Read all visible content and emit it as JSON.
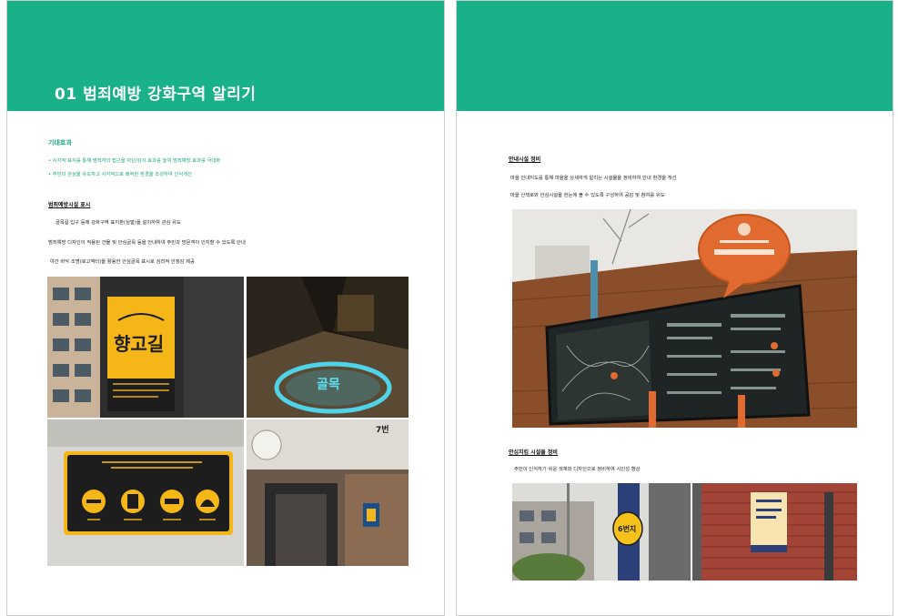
{
  "left_page": {
    "title": "01 범죄예방 강화구역 알리기",
    "section_title": "기대효과",
    "bullets": [
      "• 시각적 표지를 통해 범죄자의 접근을 차단/감시 효과를 높여 범죄예방 효과를 극대화",
      "• 주민의 관심을 유도하고 시각적으로 쾌적한 환경을 조성하여 인식개선"
    ],
    "subheading": "범죄예방시설 표시",
    "lines": [
      "골목길 입구 등에 강화구역 표지판(심벌)을 설치하여 관심 유도",
      "범죄예방 디자인이 적용된 건물 및 안심골목 등을 안내하여 주민과 방문객이 인지할 수 있도록 안내",
      "야간 바닥 조명(로고젝터)을 활용한 안심골목 표시로 심리적 안정감 제공"
    ],
    "photo_texts": {
      "yellow_sign_title": "향고길",
      "floor_light": "골목",
      "footprint_sign": "7번"
    }
  },
  "right_page": {
    "subheading_1": "안내시설 정비",
    "lines_1": [
      "마을 안내지도를 통해 마을을 상세하게 알리는 시설물을 정비하여 안내 환경을 개선",
      "마을 산책로와 안심시설을 한눈에 볼 수 있도록 구성하여 공감 및 참여를 유도"
    ],
    "subheading_2": "안심지킴 시설물 정비",
    "lines_2": [
      "주민이 인식하기 쉬운 색채와 디자인으로 정비하여 시인성 향상"
    ],
    "photo_texts": {
      "pole_sign": "6번지"
    }
  },
  "colors": {
    "brand_green": "#19b18a",
    "brand_text_green": "#19a480",
    "sign_yellow": "#f5b617",
    "sign_orange": "#e06a2f",
    "sign_dark": "#1d1d1d"
  }
}
